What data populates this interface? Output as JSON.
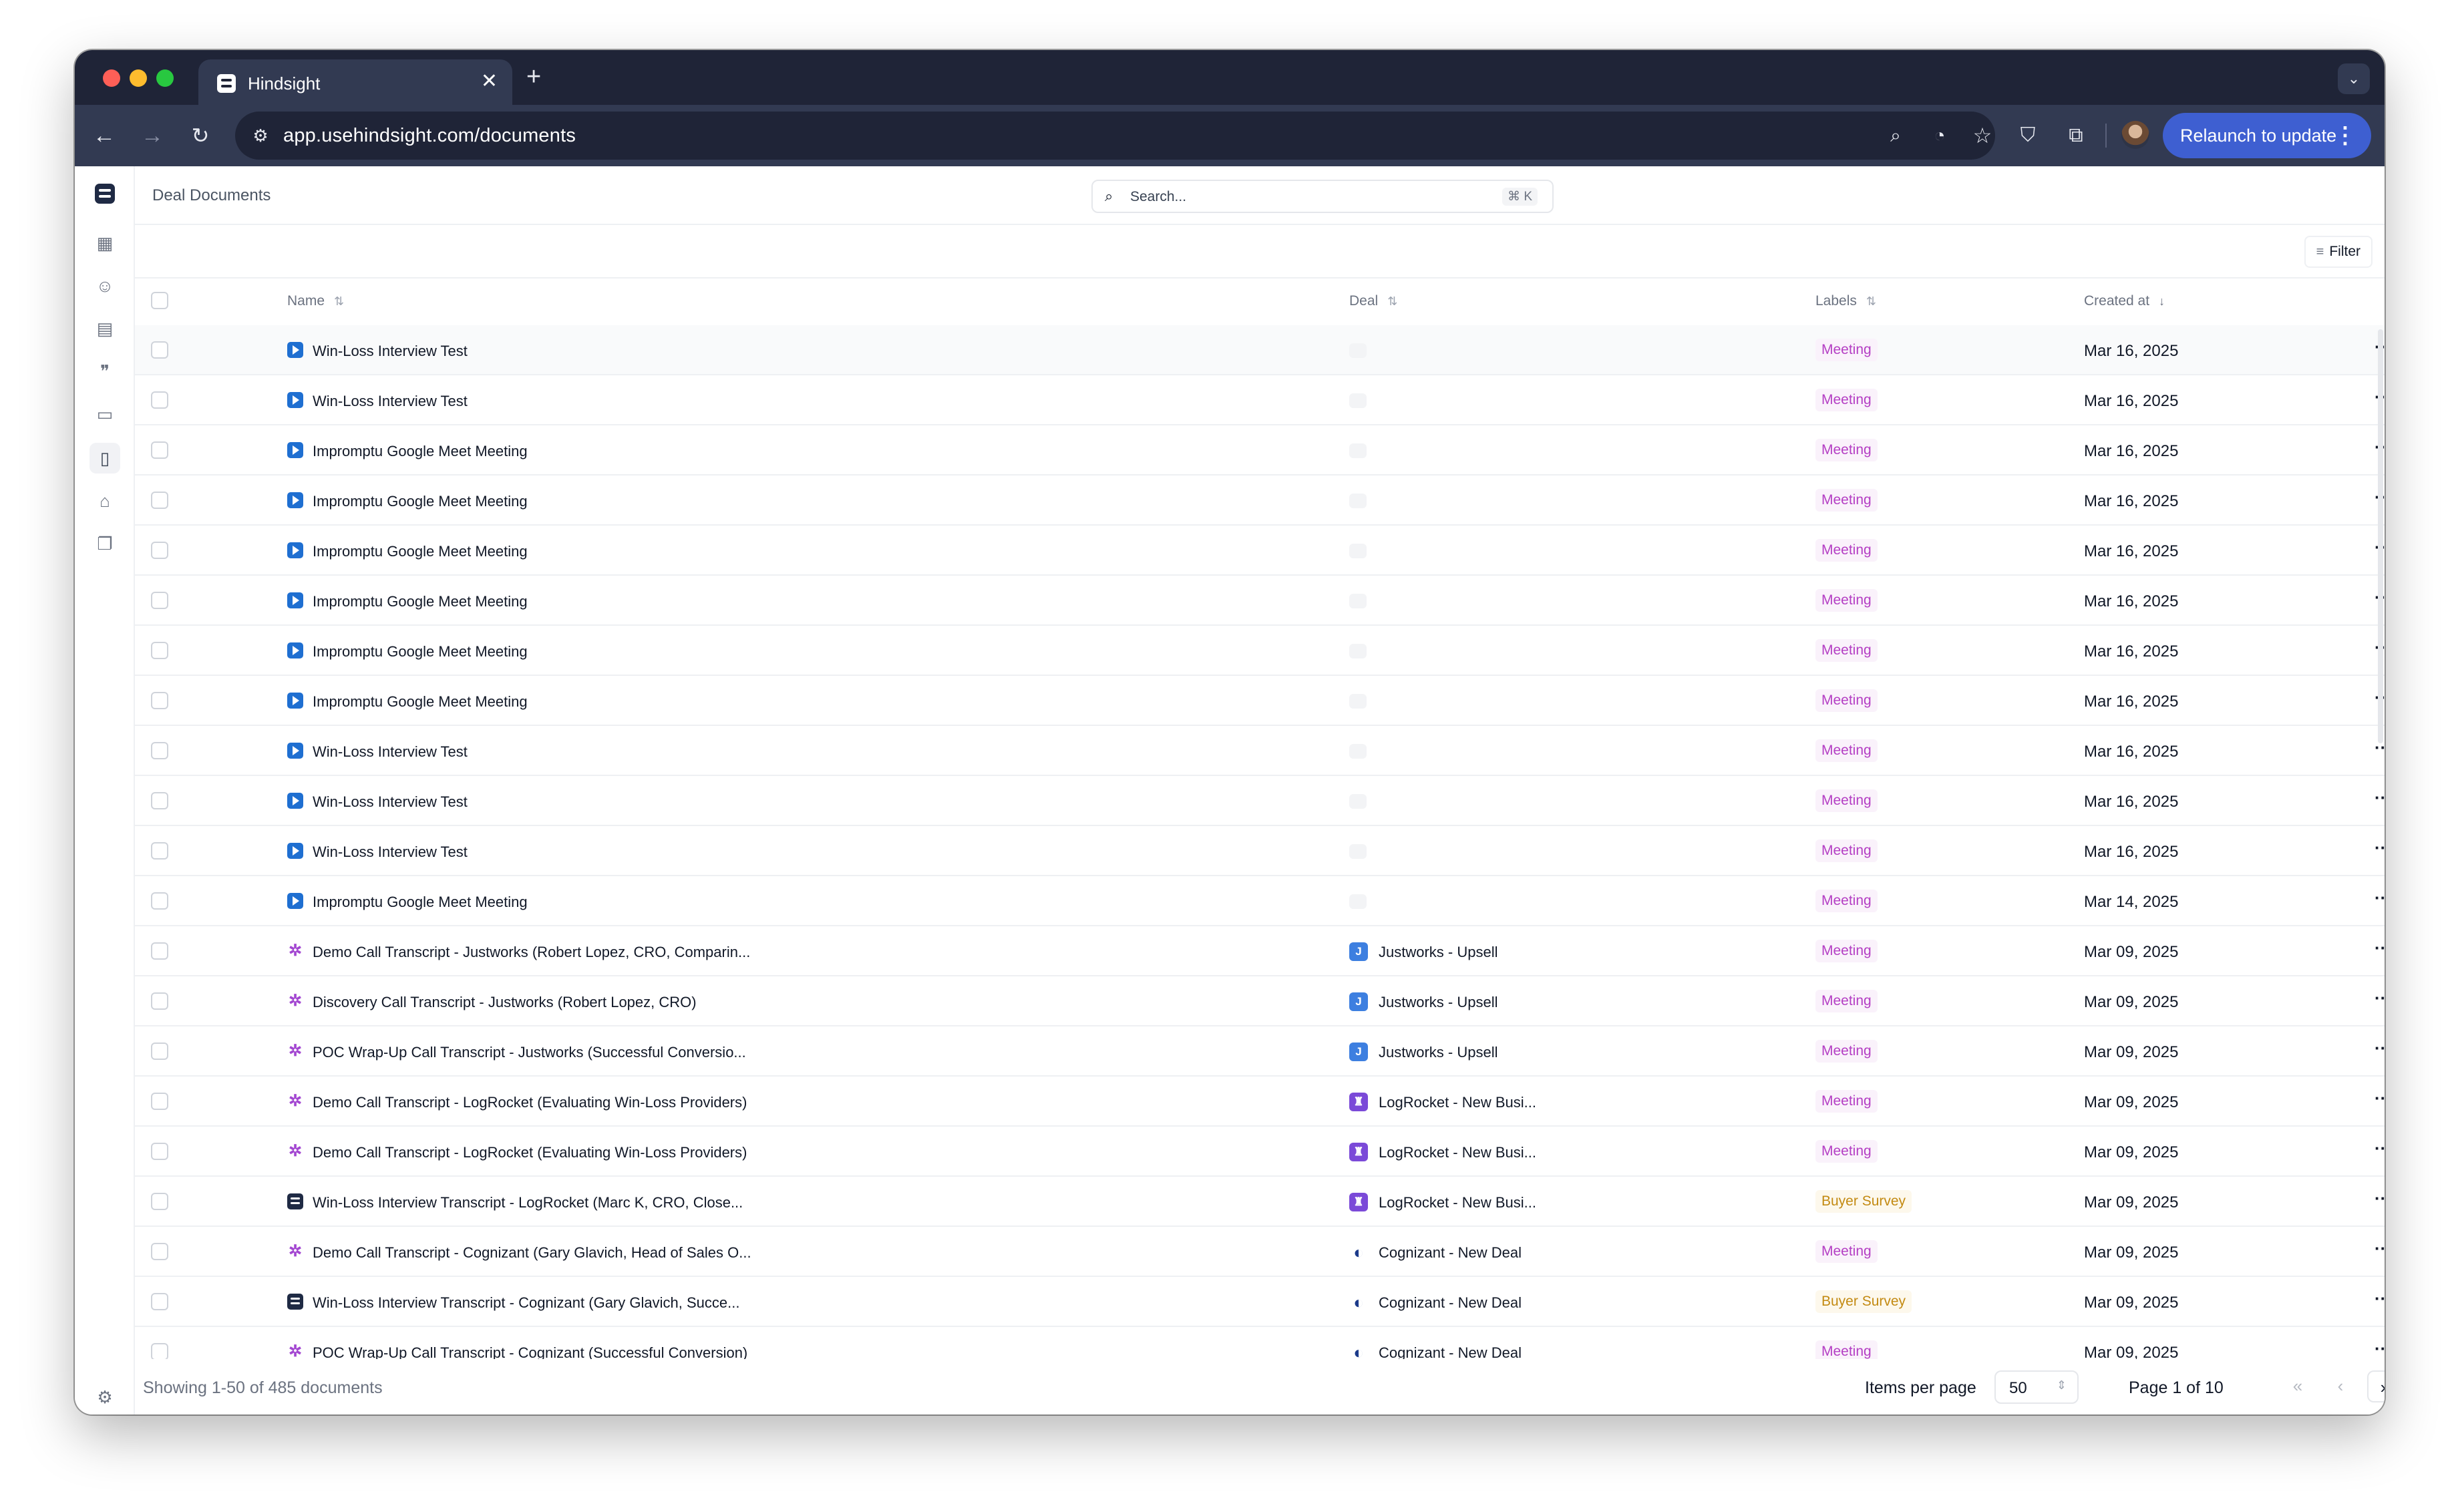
{
  "browser": {
    "tab_title": "Hindsight",
    "tab_close": "✕",
    "new_tab": "+",
    "tab_menu": "⌄",
    "url": "app.usehindsight.com/documents",
    "relaunch_label": "Relaunch to update",
    "icons": [
      "back-arrow-icon",
      "forward-arrow-icon",
      "reload-icon",
      "site-settings-icon",
      "zoom-icon",
      "performance-icon",
      "bookmark-star-icon",
      "bitwarden-shield-icon",
      "extensions-puzzle-icon",
      "profile-avatar",
      "kebab-menu-icon"
    ]
  },
  "app": {
    "page_title": "Deal Documents",
    "search": {
      "placeholder": "Search...",
      "shortcut": "⌘ K"
    },
    "filter_label": "Filter",
    "columns": {
      "name": "Name",
      "deal": "Deal",
      "labels": "Labels",
      "created_at": "Created at"
    },
    "rows": [
      {
        "name": "Win-Loss Interview Test",
        "source": "zoom",
        "deal": "",
        "deal_logo": "",
        "label": "Meeting",
        "created": "Mar 16, 2025"
      },
      {
        "name": "Win-Loss Interview Test",
        "source": "zoom",
        "deal": "",
        "deal_logo": "",
        "label": "Meeting",
        "created": "Mar 16, 2025"
      },
      {
        "name": "Impromptu Google Meet Meeting",
        "source": "zoom",
        "deal": "",
        "deal_logo": "",
        "label": "Meeting",
        "created": "Mar 16, 2025"
      },
      {
        "name": "Impromptu Google Meet Meeting",
        "source": "zoom",
        "deal": "",
        "deal_logo": "",
        "label": "Meeting",
        "created": "Mar 16, 2025"
      },
      {
        "name": "Impromptu Google Meet Meeting",
        "source": "zoom",
        "deal": "",
        "deal_logo": "",
        "label": "Meeting",
        "created": "Mar 16, 2025"
      },
      {
        "name": "Impromptu Google Meet Meeting",
        "source": "zoom",
        "deal": "",
        "deal_logo": "",
        "label": "Meeting",
        "created": "Mar 16, 2025"
      },
      {
        "name": "Impromptu Google Meet Meeting",
        "source": "zoom",
        "deal": "",
        "deal_logo": "",
        "label": "Meeting",
        "created": "Mar 16, 2025"
      },
      {
        "name": "Impromptu Google Meet Meeting",
        "source": "zoom",
        "deal": "",
        "deal_logo": "",
        "label": "Meeting",
        "created": "Mar 16, 2025"
      },
      {
        "name": "Win-Loss Interview Test",
        "source": "zoom",
        "deal": "",
        "deal_logo": "",
        "label": "Meeting",
        "created": "Mar 16, 2025"
      },
      {
        "name": "Win-Loss Interview Test",
        "source": "zoom",
        "deal": "",
        "deal_logo": "",
        "label": "Meeting",
        "created": "Mar 16, 2025"
      },
      {
        "name": "Win-Loss Interview Test",
        "source": "zoom",
        "deal": "",
        "deal_logo": "",
        "label": "Meeting",
        "created": "Mar 16, 2025"
      },
      {
        "name": "Impromptu Google Meet Meeting",
        "source": "zoom",
        "deal": "",
        "deal_logo": "",
        "label": "Meeting",
        "created": "Mar 14, 2025"
      },
      {
        "name": "Demo Call Transcript - Justworks (Robert Lopez, CRO, Comparin...",
        "source": "gong",
        "deal": "Justworks - Upsell",
        "deal_logo": "justworks",
        "label": "Meeting",
        "created": "Mar 09, 2025"
      },
      {
        "name": "Discovery Call Transcript - Justworks (Robert Lopez, CRO)",
        "source": "gong",
        "deal": "Justworks - Upsell",
        "deal_logo": "justworks",
        "label": "Meeting",
        "created": "Mar 09, 2025"
      },
      {
        "name": "POC Wrap-Up Call Transcript - Justworks (Successful Conversio...",
        "source": "gong",
        "deal": "Justworks - Upsell",
        "deal_logo": "justworks",
        "label": "Meeting",
        "created": "Mar 09, 2025"
      },
      {
        "name": "Demo Call Transcript - LogRocket (Evaluating Win-Loss Providers)",
        "source": "gong",
        "deal": "LogRocket - New Busi...",
        "deal_logo": "logrocket",
        "label": "Meeting",
        "created": "Mar 09, 2025"
      },
      {
        "name": "Demo Call Transcript - LogRocket (Evaluating Win-Loss Providers)",
        "source": "gong",
        "deal": "LogRocket - New Busi...",
        "deal_logo": "logrocket",
        "label": "Meeting",
        "created": "Mar 09, 2025"
      },
      {
        "name": "Win-Loss Interview Transcript - LogRocket (Marc K, CRO, Close...",
        "source": "hindsight",
        "deal": "LogRocket - New Busi...",
        "deal_logo": "logrocket",
        "label": "Buyer Survey",
        "created": "Mar 09, 2025"
      },
      {
        "name": "Demo Call Transcript - Cognizant (Gary Glavich, Head of Sales O...",
        "source": "gong",
        "deal": "Cognizant - New Deal",
        "deal_logo": "cognizant",
        "label": "Meeting",
        "created": "Mar 09, 2025"
      },
      {
        "name": "Win-Loss Interview Transcript - Cognizant (Gary Glavich, Succe...",
        "source": "hindsight",
        "deal": "Cognizant - New Deal",
        "deal_logo": "cognizant",
        "label": "Buyer Survey",
        "created": "Mar 09, 2025"
      },
      {
        "name": "POC Wrap-Up Call Transcript - Cognizant (Successful Conversion)",
        "source": "gong",
        "deal": "Cognizant - New Deal",
        "deal_logo": "cognizant",
        "label": "Meeting",
        "created": "Mar 09, 2025"
      }
    ],
    "footer": {
      "showing": "Showing 1-50 of 485 documents",
      "items_per_page_label": "Items per page",
      "items_per_page": "50",
      "page_info": "Page 1 of 10"
    },
    "colors": {
      "meeting_label": "#b43ec4",
      "buyer_survey_label": "#c38a12",
      "relaunch_button": "#3e5fd1",
      "browser_chrome": "#1f2437"
    }
  }
}
